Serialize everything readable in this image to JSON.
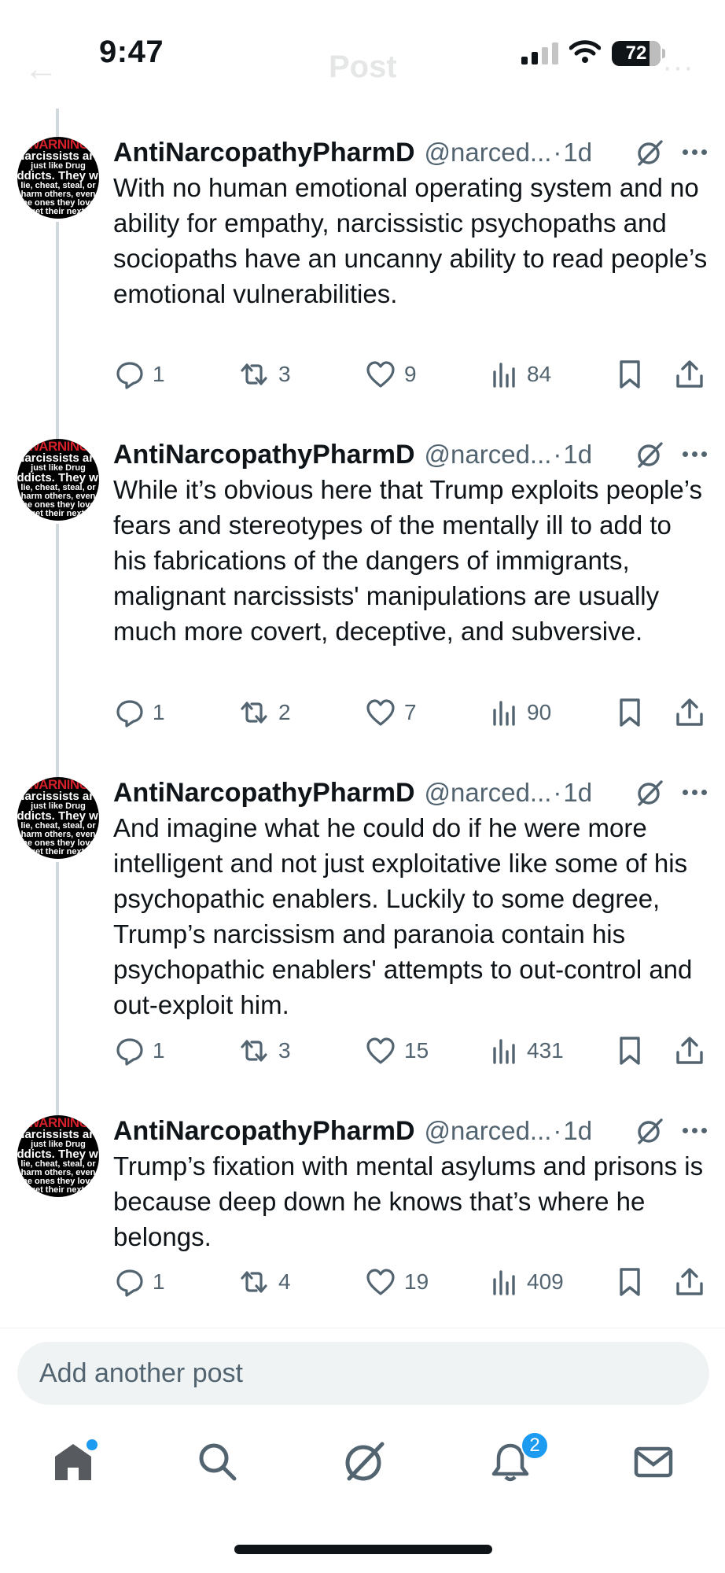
{
  "status_bar": {
    "time": "9:47",
    "battery": "72"
  },
  "header": {
    "back": "←",
    "title": "Post",
    "more": "···"
  },
  "avatar_text": {
    "warning": "WARNING",
    "l1": "Narcissists are",
    "l2": "just like Drug",
    "l3": "Addicts. They will",
    "l4": "lie, cheat, steal, or",
    "l5": "harm others, even",
    "l6": "the ones they love,",
    "l7": "to get their next fix"
  },
  "posts": [
    {
      "name": "AntiNarcopathyPharmD",
      "handle": "@narced...",
      "separator": "·",
      "age": "1d",
      "text": "With no human emotional operating system and no ability for empathy, narcissistic psychopaths and sociopaths have an uncanny ability to read people’s emotional vulnerabilities.",
      "replies": "1",
      "reposts": "3",
      "likes": "9",
      "views": "84"
    },
    {
      "name": "AntiNarcopathyPharmD",
      "handle": "@narced...",
      "separator": "·",
      "age": "1d",
      "text": "While it’s obvious here that Trump exploits people’s fears and stereotypes of the mentally ill to add to his fabrications of the dangers of immigrants, malignant narcissists' manipulations are usually much more covert, deceptive, and subversive.",
      "replies": "1",
      "reposts": "2",
      "likes": "7",
      "views": "90"
    },
    {
      "name": "AntiNarcopathyPharmD",
      "handle": "@narced...",
      "separator": "·",
      "age": "1d",
      "text": "And imagine what he could do if he were more intelligent and not just exploitative like some of his psychopathic enablers. Luckily to some degree, Trump’s narcissism and paranoia contain his psychopathic enablers' attempts to out-control and out-exploit him.",
      "replies": "1",
      "reposts": "3",
      "likes": "15",
      "views": "431"
    },
    {
      "name": "AntiNarcopathyPharmD",
      "handle": "@narced...",
      "separator": "·",
      "age": "1d",
      "text": "Trump’s fixation with mental asylums and prisons is because deep down he knows that’s where he belongs.",
      "replies": "1",
      "reposts": "4",
      "likes": "19",
      "views": "409"
    }
  ],
  "composer": {
    "placeholder": "Add another post"
  },
  "bottom_nav": {
    "notifications_badge": "2",
    "icons": [
      "home-icon",
      "search-icon",
      "grok-icon",
      "notifications-icon",
      "messages-icon"
    ]
  },
  "colors": {
    "text": "#0f1419",
    "secondary": "#536471",
    "accent": "#1d9bf0",
    "thread_line": "#cfd9de"
  }
}
